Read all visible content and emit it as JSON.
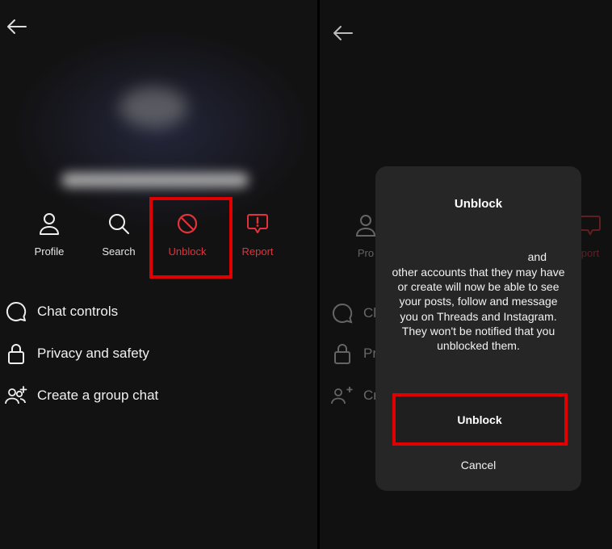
{
  "left": {
    "actions": [
      {
        "label": "Profile",
        "icon": "person-icon"
      },
      {
        "label": "Search",
        "icon": "search-icon"
      },
      {
        "label": "Unblock",
        "icon": "block-icon"
      },
      {
        "label": "Report",
        "icon": "report-icon"
      }
    ],
    "menu": [
      {
        "label": "Chat controls",
        "icon": "chat-bubble-icon"
      },
      {
        "label": "Privacy and safety",
        "icon": "lock-icon"
      },
      {
        "label": "Create a group chat",
        "icon": "add-people-icon"
      }
    ]
  },
  "right": {
    "dim_actions": [
      {
        "label": "Pro"
      },
      {
        "label": "port"
      }
    ],
    "dim_menu": [
      {
        "label": "Cl"
      },
      {
        "label": "Pr"
      },
      {
        "label": "Cr"
      }
    ],
    "dialog": {
      "title": "Unblock",
      "body_tail": "and",
      "body": "other accounts that they may have or create will now be able to see your posts, follow and message you on Threads and Instagram. They won't be notified that you unblocked them.",
      "confirm_label": "Unblock",
      "cancel_label": "Cancel"
    }
  },
  "colors": {
    "background": "#121212",
    "danger": "#e2333c",
    "highlight": "#e00000",
    "dialog": "#262626"
  }
}
